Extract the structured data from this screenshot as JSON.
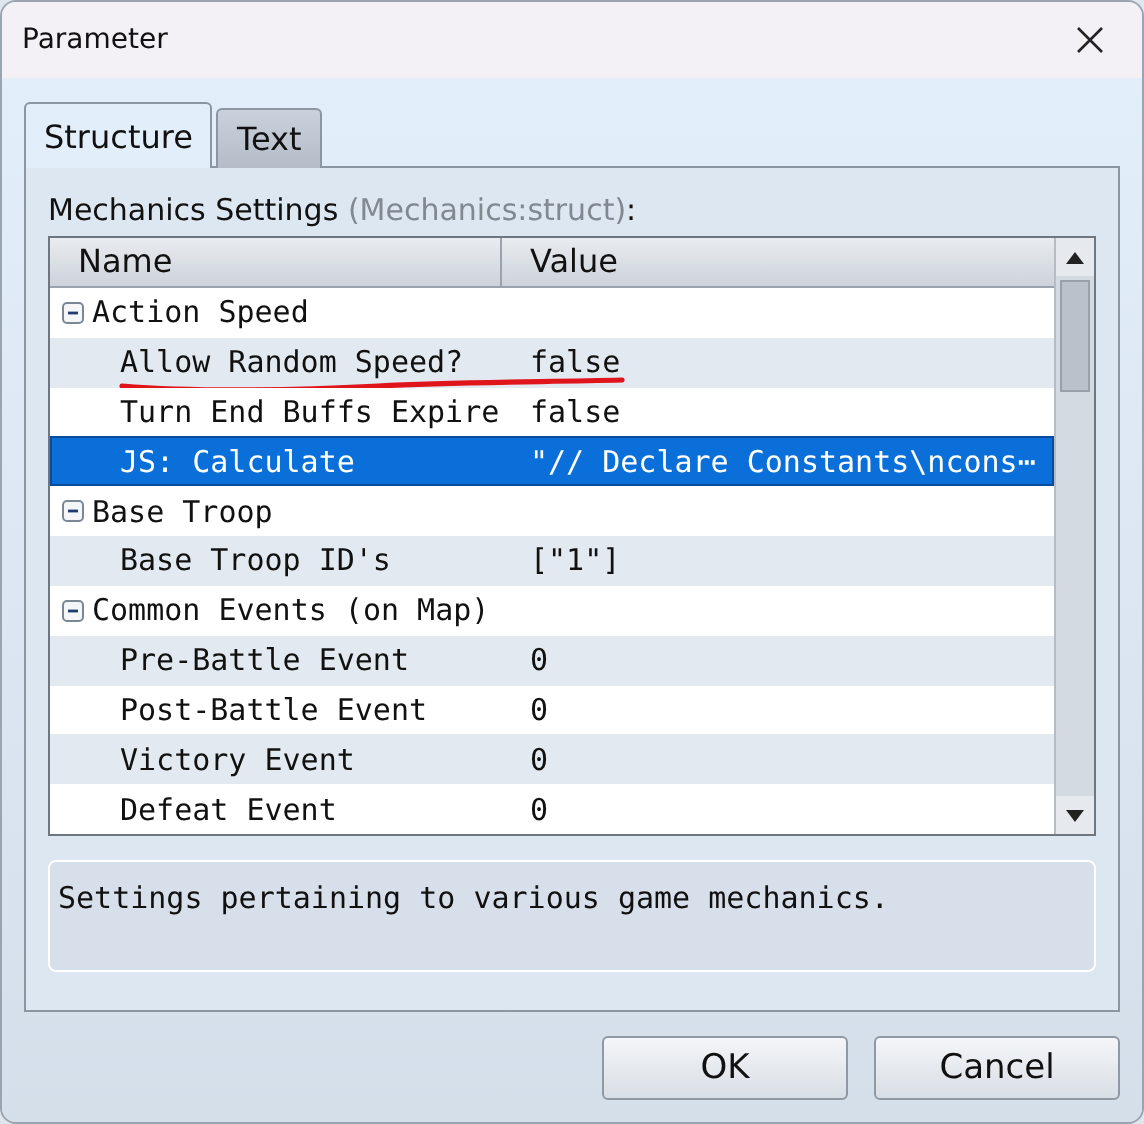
{
  "window": {
    "title": "Parameter"
  },
  "tabs": [
    {
      "label": "Structure",
      "selected": true
    },
    {
      "label": "Text",
      "selected": false
    }
  ],
  "section": {
    "label": "Mechanics Settings",
    "type_hint": "(Mechanics:struct)",
    "suffix": ":"
  },
  "tree": {
    "columns": [
      "Name",
      "Value"
    ],
    "items": [
      {
        "name": "Action Speed",
        "expanded": true,
        "children": [
          {
            "name": "Allow Random Speed?",
            "value": "false",
            "selected": false,
            "underlined": true
          },
          {
            "name": "Turn End Buffs Expire",
            "value": "false",
            "selected": false,
            "underlined": false
          },
          {
            "name": "JS: Calculate",
            "value": "\"// Declare Constants\\ncons⋯",
            "selected": true,
            "underlined": false
          }
        ]
      },
      {
        "name": "Base Troop",
        "expanded": true,
        "children": [
          {
            "name": "Base Troop ID's",
            "value": "[\"1\"]",
            "selected": false,
            "underlined": false
          }
        ]
      },
      {
        "name": "Common Events (on Map)",
        "expanded": true,
        "children": [
          {
            "name": "Pre-Battle Event",
            "value": "0",
            "selected": false,
            "underlined": false
          },
          {
            "name": "Post-Battle Event",
            "value": "0",
            "selected": false,
            "underlined": false
          },
          {
            "name": "Victory Event",
            "value": "0",
            "selected": false,
            "underlined": false
          },
          {
            "name": "Defeat Event",
            "value": "0",
            "selected": false,
            "underlined": false
          }
        ]
      }
    ]
  },
  "description": "Settings pertaining to various game mechanics.",
  "buttons": [
    "OK",
    "Cancel"
  ]
}
